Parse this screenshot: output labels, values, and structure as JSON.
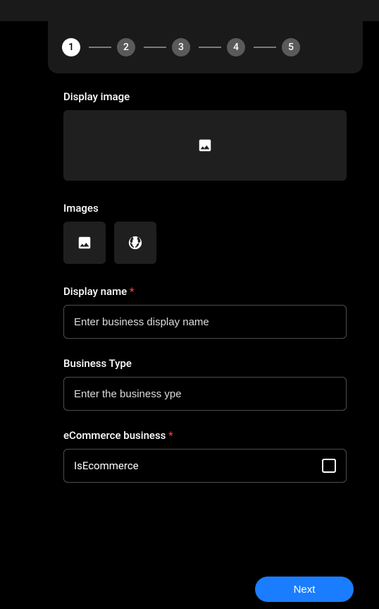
{
  "stepper": {
    "steps": [
      "1",
      "2",
      "3",
      "4",
      "5"
    ],
    "active": 0
  },
  "labels": {
    "display_image": "Display image",
    "images": "Images",
    "display_name": "Display name",
    "business_type": "Business Type",
    "ecommerce": "eCommerce business"
  },
  "fields": {
    "display_name_placeholder": "Enter business display name",
    "business_type_placeholder": "Enter the business ype",
    "is_ecommerce_label": "IsEcommerce"
  },
  "buttons": {
    "next": "Next"
  },
  "required_marker": "*"
}
